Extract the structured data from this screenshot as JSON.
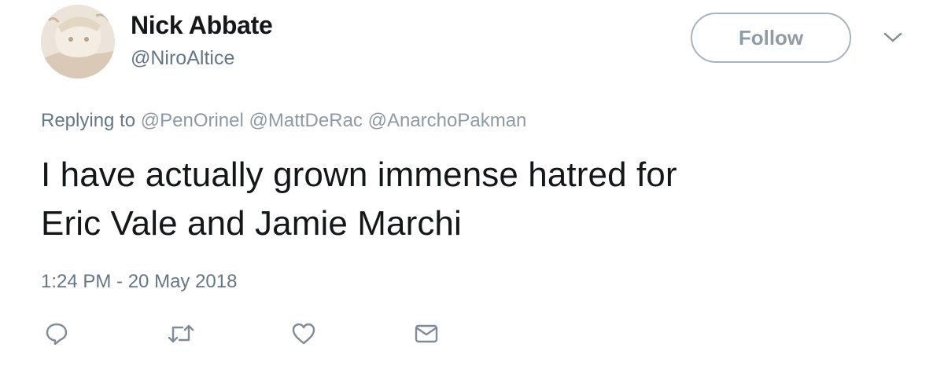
{
  "author": {
    "display_name": "Nick Abbate",
    "handle": "@NiroAltice"
  },
  "follow_label": "Follow",
  "replying": {
    "prefix": "Replying to",
    "mentions": [
      "@PenOrinel",
      "@MattDeRac",
      "@AnarchoPakman"
    ]
  },
  "tweet": {
    "lines": [
      "I have actually grown immense hatred for",
      "Eric Vale and Jamie Marchi"
    ]
  },
  "timestamp": "1:24 PM - 20 May 2018",
  "icons": {
    "caret": "chevron-down-icon",
    "reply": "reply-icon",
    "retweet": "retweet-icon",
    "like": "heart-icon",
    "dm": "envelope-icon"
  },
  "colors": {
    "text": "#14171a",
    "secondary": "#657786",
    "mention": "#8d9aa5",
    "icon": "#7f8b96",
    "follow_border": "#a7b4be"
  }
}
